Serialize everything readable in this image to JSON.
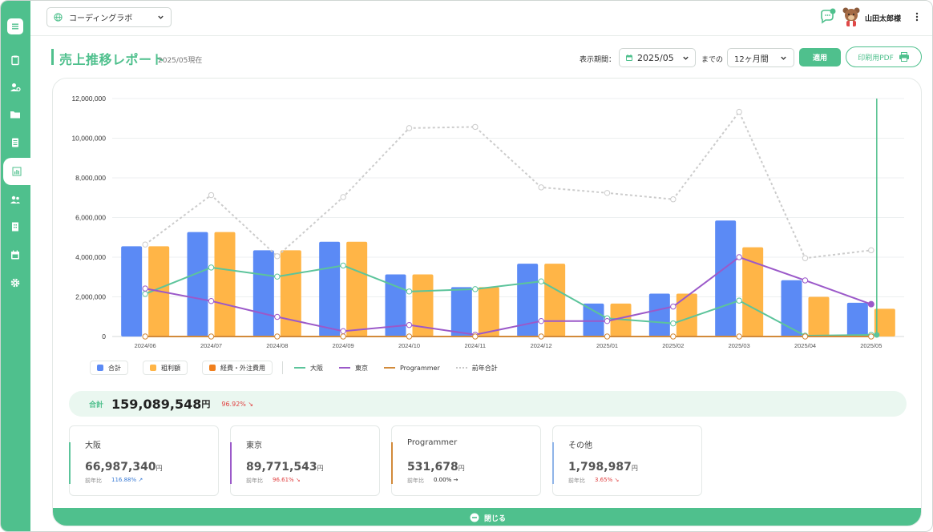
{
  "org": {
    "name": "コーディングラボ"
  },
  "user": {
    "name": "山田太郎様",
    "notification_count": "1"
  },
  "page": {
    "title": "売上推移レポート",
    "subtitle": "2025/05現在"
  },
  "controls": {
    "period_label": "表示期間：",
    "month_value": "2025/05",
    "made_label": "までの",
    "range_value": "12ヶ月間",
    "apply_label": "適用",
    "pdf_label": "印刷用PDF"
  },
  "legend": {
    "total": "合計",
    "gross": "粗利額",
    "expense": "経費・外注費用",
    "osaka": "大阪",
    "tokyo": "東京",
    "programmer": "Programmer",
    "prev_total": "前年合計"
  },
  "colors": {
    "accent": "#4fc08d",
    "total_bar": "#5b8af5",
    "gross_bar": "#ffb547",
    "expense_bar": "#f07f1e",
    "osaka": "#5cc49b",
    "tokyo": "#9b59c9",
    "programmer": "#d28a3a",
    "prev": "#cccccc"
  },
  "chart_data": {
    "type": "bar",
    "categories": [
      "2024/06",
      "2024/07",
      "2024/08",
      "2024/09",
      "2024/10",
      "2024/11",
      "2024/12",
      "2025/01",
      "2025/02",
      "2025/03",
      "2025/04",
      "2025/05"
    ],
    "ylim": [
      0,
      12000000
    ],
    "yticks": [
      "0",
      "2,000,000",
      "4,000,000",
      "6,000,000",
      "8,000,000",
      "10,000,000",
      "12,000,000"
    ],
    "grid": true,
    "legend_position": "bottom",
    "bars": [
      {
        "name": "合計",
        "values": [
          4550000,
          5270000,
          4350000,
          4780000,
          3130000,
          2490000,
          3670000,
          1660000,
          2160000,
          5850000,
          2840000,
          1700000
        ]
      },
      {
        "name": "粗利額",
        "values": [
          4550000,
          5270000,
          4350000,
          4780000,
          3130000,
          2490000,
          3670000,
          1660000,
          2160000,
          4500000,
          2000000,
          1400000
        ]
      },
      {
        "name": "経費・外注費用",
        "values": [
          0,
          0,
          0,
          0,
          0,
          0,
          0,
          0,
          0,
          0,
          0,
          0
        ]
      }
    ],
    "lines": [
      {
        "name": "大阪",
        "values": [
          2150000,
          3480000,
          3020000,
          3580000,
          2270000,
          2390000,
          2780000,
          920000,
          660000,
          1810000,
          40000,
          80000
        ]
      },
      {
        "name": "東京",
        "values": [
          2420000,
          1790000,
          990000,
          270000,
          580000,
          90000,
          780000,
          780000,
          1510000,
          4000000,
          2830000,
          1630000
        ]
      },
      {
        "name": "Programmer",
        "values": [
          0,
          0,
          0,
          0,
          0,
          0,
          0,
          0,
          0,
          0,
          0,
          0
        ]
      },
      {
        "name": "前年合計",
        "values": [
          4640000,
          7130000,
          4050000,
          7030000,
          10510000,
          10570000,
          7520000,
          7240000,
          6920000,
          11330000,
          3950000,
          4350000
        ]
      }
    ]
  },
  "summary": {
    "total_label": "合計",
    "total_value": "159,089,548",
    "total_unit": "円",
    "total_pct": "96.92% ↘"
  },
  "regions": [
    {
      "name": "大阪",
      "value": "66,987,340",
      "unit": "円",
      "cmp_label": "前年比",
      "pct": "116.88% ↗",
      "pct_color": "#3a7bd5",
      "color": "#5cc49b"
    },
    {
      "name": "東京",
      "value": "89,771,543",
      "unit": "円",
      "cmp_label": "前年比",
      "pct": "96.61% ↘",
      "pct_color": "#e04040",
      "color": "#9b59c9"
    },
    {
      "name": "Programmer",
      "value": "531,678",
      "unit": "円",
      "cmp_label": "前年比",
      "pct": "0.00% →",
      "pct_color": "#222222",
      "color": "#d28a3a"
    },
    {
      "name": "その他",
      "value": "1,798,987",
      "unit": "円",
      "cmp_label": "前年比",
      "pct": "3.65% ↘",
      "pct_color": "#e04040",
      "color": "#8fb4e8"
    }
  ],
  "close_label": "閉じる"
}
